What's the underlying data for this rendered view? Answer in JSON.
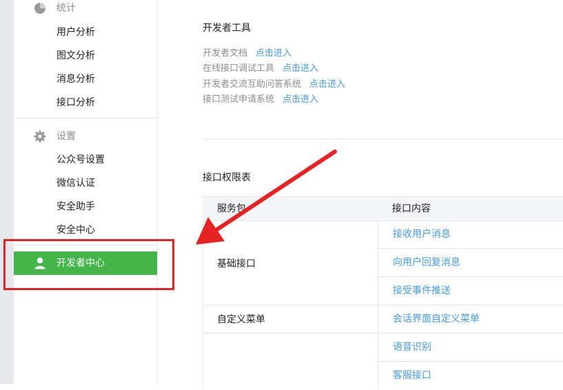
{
  "sidebar": {
    "stats": {
      "label": "统计",
      "icon": "pie-chart-icon",
      "items": [
        "用户分析",
        "图文分析",
        "消息分析",
        "接口分析"
      ]
    },
    "settings": {
      "label": "设置",
      "icon": "gear-icon",
      "items": [
        "公众号设置",
        "微信认证",
        "安全助手",
        "安全中心"
      ]
    },
    "active": {
      "label": "开发者中心",
      "icon": "user-icon"
    }
  },
  "dev_tools": {
    "title": "开发者工具",
    "rows": [
      {
        "label": "开发者文档",
        "link": "点击进入"
      },
      {
        "label": "在线接口调试工具",
        "link": "点击进入"
      },
      {
        "label": "开发者交流互助问答系统",
        "link": "点击进入"
      },
      {
        "label": "接口测试申请系统",
        "link": "点击进入"
      }
    ]
  },
  "permissions": {
    "title": "接口权限表",
    "header": {
      "service": "服务包",
      "content": "接口内容"
    },
    "groups": [
      {
        "name": "基础接口",
        "items": [
          "接收用户消息",
          "向用户回复消息",
          "接受事件推送"
        ]
      },
      {
        "name": "自定义菜单",
        "items": [
          "会话界面自定义菜单"
        ]
      },
      {
        "name": "",
        "items": [
          "语音识别",
          "客服接口"
        ]
      }
    ]
  },
  "colors": {
    "active_green": "#44b549",
    "link_blue": "#459ae9",
    "annotation_red": "#e62323"
  }
}
